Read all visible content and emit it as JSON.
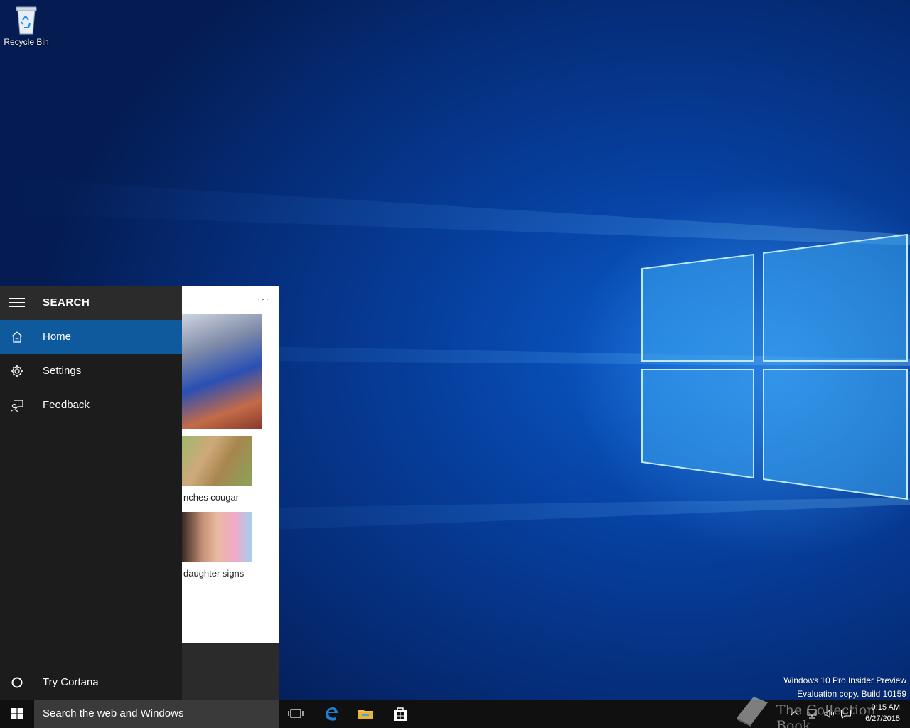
{
  "desktop": {
    "icons": [
      {
        "label": "Recycle Bin",
        "icon": "recycle-bin-icon"
      }
    ],
    "watermark": {
      "line1": "Windows 10 Pro Insider Preview",
      "line2": "Evaluation copy. Build 10159"
    }
  },
  "search_panel": {
    "title": "SEARCH",
    "nav_items": [
      {
        "label": "Home",
        "icon": "home-icon",
        "active": true
      },
      {
        "label": "Settings",
        "icon": "gear-icon",
        "active": false
      },
      {
        "label": "Feedback",
        "icon": "feedback-icon",
        "active": false
      }
    ],
    "cortana_label": "Try Cortana",
    "more_label": "···",
    "news": [
      {
        "caption": ""
      },
      {
        "caption": "nches cougar"
      },
      {
        "caption": " daughter signs"
      }
    ]
  },
  "taskbar": {
    "search_placeholder": "Search the web and Windows",
    "pinned": [
      {
        "name": "Task View",
        "icon": "task-view-icon"
      },
      {
        "name": "Microsoft Edge",
        "icon": "edge-icon"
      },
      {
        "name": "File Explorer",
        "icon": "file-explorer-icon"
      },
      {
        "name": "Store",
        "icon": "store-icon"
      }
    ],
    "clock": {
      "time": "9:15 AM",
      "date": "6/27/2015"
    },
    "tray_icons": [
      "chevron-up-icon",
      "network-icon",
      "volume-icon",
      "action-center-icon"
    ]
  },
  "overlay": {
    "brand_text": "The Collection Book"
  },
  "colors": {
    "accent": "#0f5a9c",
    "nav_background": "#1c1c1c",
    "taskbar_background": "#101010",
    "search_box_background": "#3a3a3a"
  }
}
